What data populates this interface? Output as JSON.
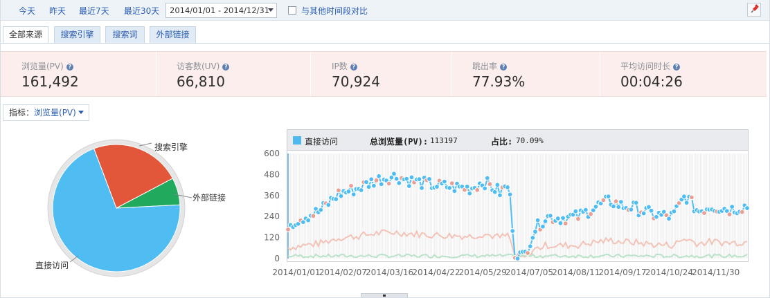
{
  "toolbar": {
    "quick_ranges": [
      "今天",
      "昨天",
      "最近7天",
      "最近30天"
    ],
    "date_range": "2014/01/01 - 2014/12/31",
    "compare_label": "与其他时间段对比",
    "compare_checked": false,
    "pin_icon": "pushpin-icon"
  },
  "tabs": [
    {
      "label": "全部来源",
      "active": true
    },
    {
      "label": "搜索引擎",
      "active": false
    },
    {
      "label": "搜索词",
      "active": false
    },
    {
      "label": "外部链接",
      "active": false
    }
  ],
  "summary": [
    {
      "label": "浏览量(PV)",
      "value": "161,492"
    },
    {
      "label": "访客数(UV)",
      "value": "66,810"
    },
    {
      "label": "IP数",
      "value": "70,924"
    },
    {
      "label": "跳出率",
      "value": "77.93%"
    },
    {
      "label": "平均访问时长",
      "value": "00:04:26"
    }
  ],
  "help_icon": "question-mark-icon",
  "indicator": {
    "label": "指标：",
    "value": "浏览量(PV)"
  },
  "chart_data": [
    {
      "type": "pie",
      "labels": [
        "直接访问",
        "搜索引擎",
        "外部链接"
      ],
      "values": [
        70.09,
        23.0,
        6.91
      ],
      "colors": [
        "#4fbdf2",
        "#e2573a",
        "#21a95e"
      ]
    },
    {
      "type": "line",
      "legend": "直接访问",
      "total_label": "总浏览量(PV):",
      "total_value": "113197",
      "share_label": "占比:",
      "share_value": "70.09%",
      "x_tick_labels": [
        "2014/01/01",
        "2014/02/07",
        "2014/03/16",
        "2014/04/22",
        "2014/05/29",
        "2014/07/05",
        "2014/08/11",
        "2014/09/17",
        "2014/10/24",
        "2014/11/30"
      ],
      "y_ticks": [
        0,
        120,
        240,
        360,
        480,
        600
      ],
      "ylim": [
        0,
        600
      ],
      "series_color": "#4fbdf2",
      "point_color": "#e8a094",
      "anchors": [
        {
          "day": 0,
          "value": 195
        },
        {
          "day": 10,
          "value": 230
        },
        {
          "day": 25,
          "value": 270
        },
        {
          "day": 40,
          "value": 370
        },
        {
          "day": 55,
          "value": 400
        },
        {
          "day": 70,
          "value": 450
        },
        {
          "day": 85,
          "value": 470
        },
        {
          "day": 100,
          "value": 440
        },
        {
          "day": 115,
          "value": 420
        },
        {
          "day": 130,
          "value": 410
        },
        {
          "day": 145,
          "value": 400
        },
        {
          "day": 155,
          "value": 440
        },
        {
          "day": 168,
          "value": 380
        },
        {
          "day": 175,
          "value": 420
        },
        {
          "day": 180,
          "value": 30
        },
        {
          "day": 187,
          "value": 10
        },
        {
          "day": 195,
          "value": 160
        },
        {
          "day": 205,
          "value": 240
        },
        {
          "day": 215,
          "value": 230
        },
        {
          "day": 230,
          "value": 240
        },
        {
          "day": 245,
          "value": 300
        },
        {
          "day": 255,
          "value": 330
        },
        {
          "day": 265,
          "value": 300
        },
        {
          "day": 275,
          "value": 290
        },
        {
          "day": 290,
          "value": 250
        },
        {
          "day": 305,
          "value": 240
        },
        {
          "day": 315,
          "value": 360
        },
        {
          "day": 325,
          "value": 270
        },
        {
          "day": 335,
          "value": 300
        },
        {
          "day": 350,
          "value": 280
        },
        {
          "day": 364,
          "value": 300
        }
      ]
    }
  ]
}
